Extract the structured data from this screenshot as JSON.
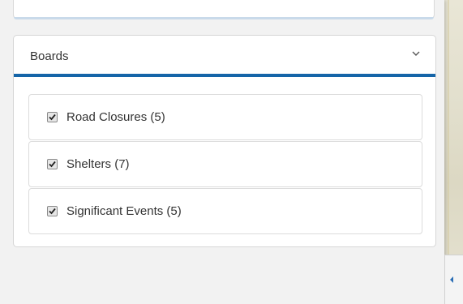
{
  "boards_panel": {
    "title": "Boards",
    "items": [
      {
        "label": "Road Closures (5)",
        "checked": true
      },
      {
        "label": "Shelters (7)",
        "checked": true
      },
      {
        "label": "Significant Events (5)",
        "checked": true
      }
    ]
  },
  "colors": {
    "accent": "#1565a8",
    "panel_border": "#d6d6d6",
    "text": "#333333",
    "background": "#f2f2f2"
  },
  "icons": {
    "header_toggle": "chevron-down-icon",
    "checkbox": "checkmark-icon",
    "collapse_tab": "caret-left-icon"
  }
}
